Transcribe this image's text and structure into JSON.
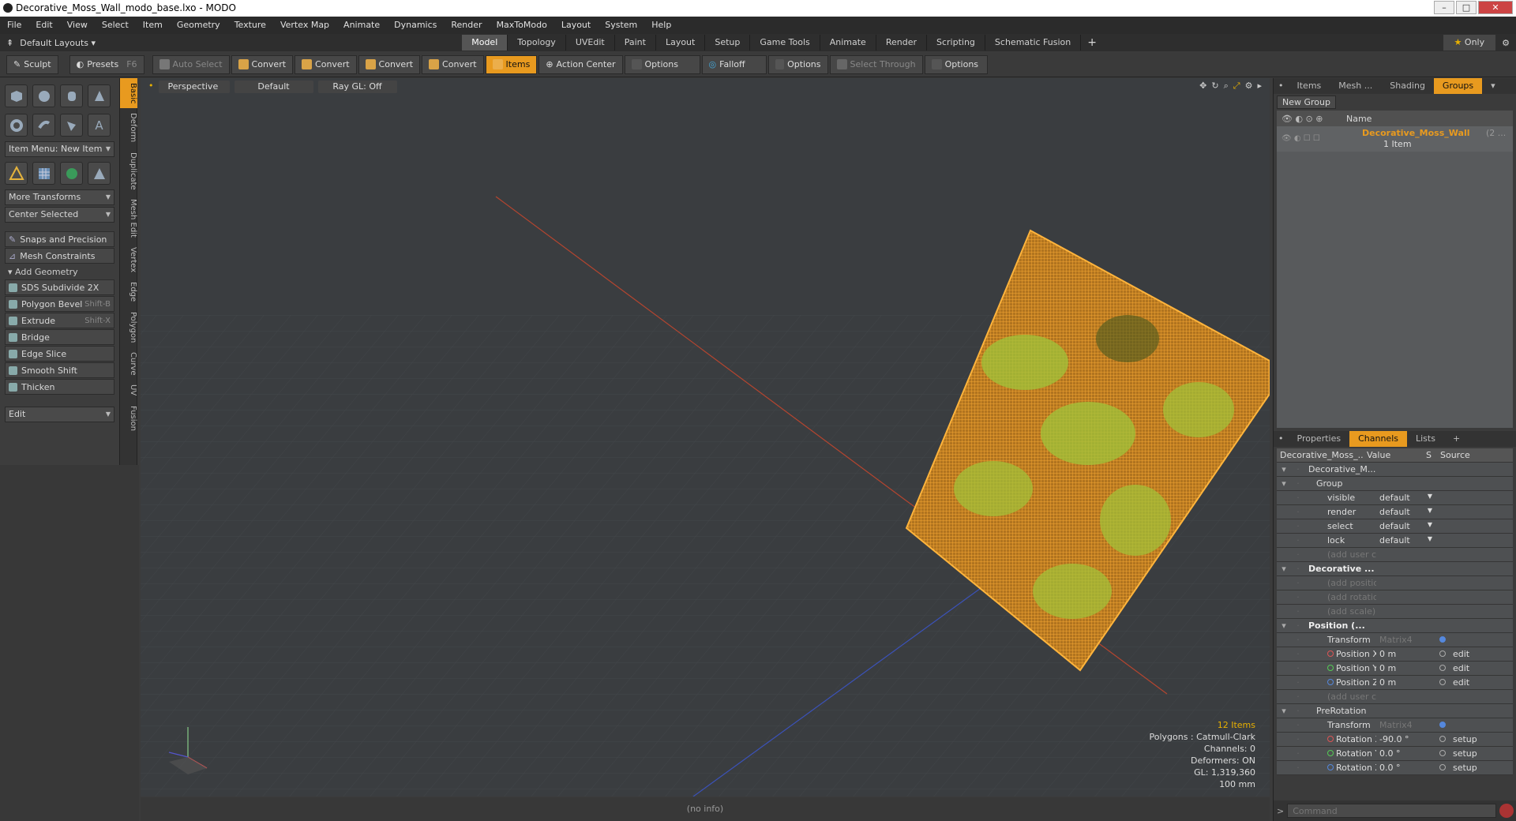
{
  "window": {
    "title": "Decorative_Moss_Wall_modo_base.lxo - MODO"
  },
  "menu": [
    "File",
    "Edit",
    "View",
    "Select",
    "Item",
    "Geometry",
    "Texture",
    "Vertex Map",
    "Animate",
    "Dynamics",
    "Render",
    "MaxToModo",
    "Layout",
    "System",
    "Help"
  ],
  "layoutbar": {
    "layout_label": "Default Layouts",
    "tabs": [
      "Model",
      "Topology",
      "UVEdit",
      "Paint",
      "Layout",
      "Setup",
      "Game Tools",
      "Animate",
      "Render",
      "Scripting",
      "Schematic Fusion"
    ],
    "active": "Model",
    "only": "Only"
  },
  "toolbar": {
    "sculpt": "Sculpt",
    "presets": "Presets",
    "presets_sc": "F6",
    "auto_select": "Auto Select",
    "convert": "Convert",
    "items": "Items",
    "action_center": "Action Center",
    "options": "Options",
    "falloff": "Falloff",
    "select_through": "Select Through"
  },
  "left": {
    "item_menu": "Item Menu: New Item",
    "more_transforms": "More Transforms",
    "center_selected": "Center Selected",
    "snaps": "Snaps and Precision",
    "mesh_constraints": "Mesh Constraints",
    "add_geometry": "Add Geometry",
    "tools": [
      {
        "label": "SDS Subdivide 2X",
        "sc": ""
      },
      {
        "label": "Polygon Bevel",
        "sc": "Shift-B"
      },
      {
        "label": "Extrude",
        "sc": "Shift-X"
      },
      {
        "label": "Bridge",
        "sc": ""
      },
      {
        "label": "Edge Slice",
        "sc": ""
      },
      {
        "label": "Smooth Shift",
        "sc": ""
      },
      {
        "label": "Thicken",
        "sc": ""
      }
    ],
    "edit": "Edit",
    "vtabs": [
      "Basic",
      "Deform",
      "Duplicate",
      "Mesh Edit",
      "Vertex",
      "Edge",
      "Polygon",
      "Curve",
      "UV",
      "Fusion"
    ]
  },
  "viewport": {
    "view": "Perspective",
    "shading": "Default",
    "raygl": "Ray GL: Off",
    "stats": {
      "items": "12 Items",
      "polygons": "Polygons : Catmull-Clark",
      "channels": "Channels: 0",
      "deformers": "Deformers: ON",
      "gl": "GL: 1,319,360",
      "unit": "100 mm"
    }
  },
  "status": "(no info)",
  "groups": {
    "tabs": [
      "Items",
      "Mesh ...",
      "Shading",
      "Groups"
    ],
    "active": "Groups",
    "new_group": "New Group",
    "col_name": "Name",
    "group_name": "Decorative_Moss_Wall",
    "group_count": "(2 ...",
    "group_items": "1 Item"
  },
  "channels": {
    "tabs": [
      "Properties",
      "Channels",
      "Lists"
    ],
    "active": "Channels",
    "head": {
      "name": "Decorative_Moss_...",
      "value": "Value",
      "s": "S",
      "source": "Source"
    },
    "rows": [
      {
        "name": "Decorative_M...",
        "value": "",
        "src": "",
        "type": "root"
      },
      {
        "name": "Group",
        "value": "",
        "src": "",
        "type": "sub"
      },
      {
        "name": "visible",
        "value": "default",
        "src": "",
        "type": "dd"
      },
      {
        "name": "render",
        "value": "default",
        "src": "",
        "type": "dd"
      },
      {
        "name": "select",
        "value": "default",
        "src": "",
        "type": "dd"
      },
      {
        "name": "lock",
        "value": "default",
        "src": "",
        "type": "dd"
      },
      {
        "name": "(add user c ...",
        "value": "",
        "src": "",
        "type": "dim"
      },
      {
        "name": "Decorative ...",
        "value": "",
        "src": "",
        "type": "bold"
      },
      {
        "name": "(add position)",
        "value": "",
        "src": "",
        "type": "dim"
      },
      {
        "name": "(add rotation)",
        "value": "",
        "src": "",
        "type": "dim"
      },
      {
        "name": "(add scale)",
        "value": "",
        "src": "",
        "type": "dim"
      },
      {
        "name": "Position (...",
        "value": "",
        "src": "",
        "type": "bold"
      },
      {
        "name": "Transform",
        "value": "Matrix4",
        "src": "",
        "type": "mat"
      },
      {
        "name": "Position X",
        "value": "0 m",
        "src": "edit",
        "type": "val"
      },
      {
        "name": "Position Y",
        "value": "0 m",
        "src": "edit",
        "type": "val"
      },
      {
        "name": "Position Z",
        "value": "0 m",
        "src": "edit",
        "type": "val"
      },
      {
        "name": "(add user c ...",
        "value": "",
        "src": "",
        "type": "dim"
      },
      {
        "name": "PreRotation",
        "value": "",
        "src": "",
        "type": "sub"
      },
      {
        "name": "Transform",
        "value": "Matrix4",
        "src": "",
        "type": "mat"
      },
      {
        "name": "Rotation X",
        "value": "-90.0 °",
        "src": "setup",
        "type": "val"
      },
      {
        "name": "Rotation Y",
        "value": "0.0 °",
        "src": "setup",
        "type": "val"
      },
      {
        "name": "Rotation Z",
        "value": "0.0 °",
        "src": "setup",
        "type": "val"
      }
    ]
  },
  "command": {
    "placeholder": "Command"
  },
  "colors": {
    "accent": "#e89a1f",
    "wire": "#f2a531",
    "moss": "#9fc43b"
  }
}
